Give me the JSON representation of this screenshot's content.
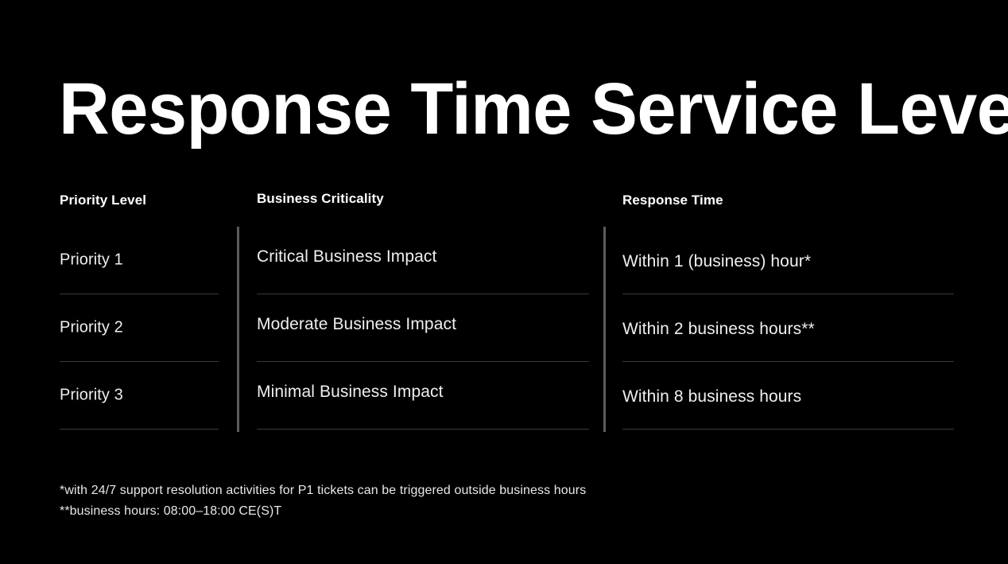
{
  "slide": {
    "title": "Response Time Service Levels",
    "background_color": "#000000",
    "text_color": "#ffffff",
    "divider_color": "#5c5c5c",
    "rule_color": "#3a3a3a"
  },
  "table": {
    "headers": {
      "priority": "Priority Level",
      "criticality": "Business Criticality",
      "response": "Response Time"
    },
    "rows": [
      {
        "priority": "Priority 1",
        "criticality": "Critical Business Impact",
        "response": "Within 1 (business) hour*"
      },
      {
        "priority": "Priority 2",
        "criticality": "Moderate Business Impact",
        "response": "Within 2 business hours**"
      },
      {
        "priority": "Priority 3",
        "criticality": "Minimal Business Impact",
        "response": "Within 8 business hours"
      }
    ]
  },
  "footnotes": [
    "*with 24/7 support resolution activities for P1 tickets can be triggered outside business hours",
    "**business hours: 08:00–18:00 CE(S)T"
  ]
}
